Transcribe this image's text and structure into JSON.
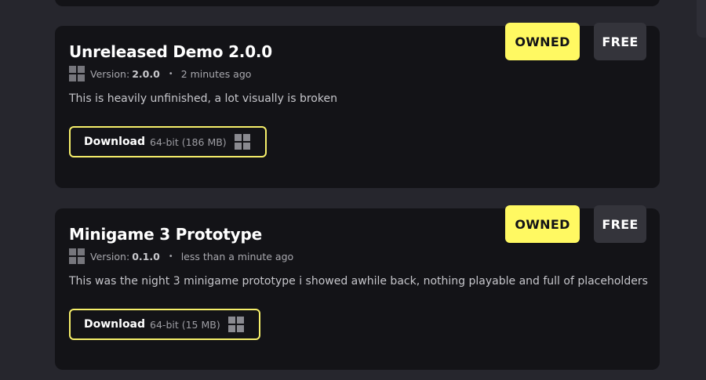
{
  "cards": [
    {
      "title": "Unreleased Demo 2.0.0",
      "version_label": "Version:",
      "version": "2.0.0",
      "time": "2 minutes ago",
      "description": "This is heavily unfinished, a lot visually is broken",
      "download_label": "Download",
      "download_size": "64-bit (186 MB)",
      "owned_label": "OWNED",
      "free_label": "FREE"
    },
    {
      "title": "Minigame 3 Prototype",
      "version_label": "Version:",
      "version": "0.1.0",
      "time": "less than a minute ago",
      "description": "This was the night 3 minigame prototype i showed awhile back, nothing playable and full of placeholders",
      "download_label": "Download",
      "download_size": "64-bit (15 MB)",
      "owned_label": "OWNED",
      "free_label": "FREE"
    }
  ],
  "icons": {
    "platform": "windows-icon",
    "separator": "•"
  },
  "colors": {
    "page_bg": "#26262d",
    "card_bg": "#131317",
    "accent_yellow": "#fff962",
    "free_bg": "#34343b"
  }
}
